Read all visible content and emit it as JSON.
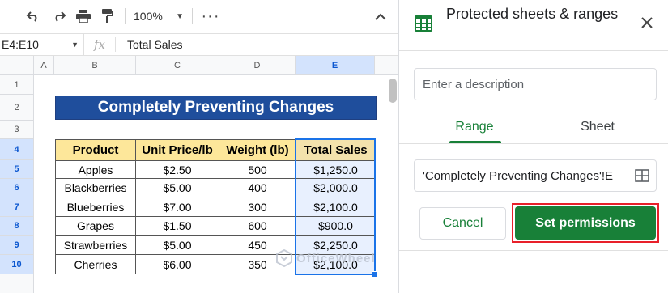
{
  "toolbar": {
    "zoom": "100%"
  },
  "formula_bar": {
    "name_box": "E4:E10",
    "fx": "fx",
    "content": "Total Sales"
  },
  "columns": [
    "A",
    "B",
    "C",
    "D",
    "E"
  ],
  "rows": [
    "1",
    "2",
    "3",
    "4",
    "5",
    "6",
    "7",
    "8",
    "9",
    "10"
  ],
  "sheet": {
    "title": "Completely Preventing Changes",
    "headers": [
      "Product",
      "Unit Price/lb",
      "Weight (lb)",
      "Total Sales"
    ],
    "data": [
      [
        "Apples",
        "$2.50",
        "500",
        "$1,250.0"
      ],
      [
        "Blackberries",
        "$5.00",
        "400",
        "$2,000.0"
      ],
      [
        "Blueberries",
        "$7.00",
        "300",
        "$2,100.0"
      ],
      [
        "Grapes",
        "$1.50",
        "600",
        "$900.0"
      ],
      [
        "Strawberries",
        "$5.00",
        "450",
        "$2,250.0"
      ],
      [
        "Cherries",
        "$6.00",
        "350",
        "$2,100.0"
      ]
    ]
  },
  "watermark": "OfficeWheel",
  "panel": {
    "title": "Protected sheets & ranges",
    "description_placeholder": "Enter a description",
    "tabs": [
      "Range",
      "Sheet"
    ],
    "active_tab": "Range",
    "range_value": "'Completely Preventing Changes'!E",
    "cancel_label": "Cancel",
    "set_permissions_label": "Set permissions"
  },
  "colors": {
    "accent_green": "#188038",
    "title_fill": "#1f4e9c",
    "header_fill": "#fde79a",
    "selection_blue": "#1a73e8",
    "highlight_red": "#e8202a"
  }
}
